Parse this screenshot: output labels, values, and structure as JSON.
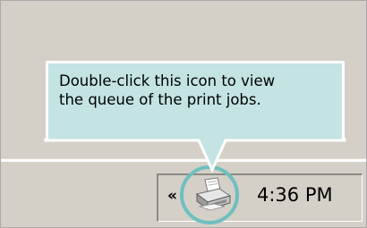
{
  "tooltip": {
    "line1": "Double-click this icon to view",
    "line2": "the queue of the print jobs."
  },
  "taskbar": {
    "expand_glyph": "«",
    "tray_icon": "printer-icon",
    "clock": "4:36 PM"
  },
  "colors": {
    "desktop": "#d4d0c8",
    "tooltip_fill": "#c4e3e3",
    "tooltip_border": "#ffffff",
    "highlight_ring": "#6fbfbf"
  }
}
